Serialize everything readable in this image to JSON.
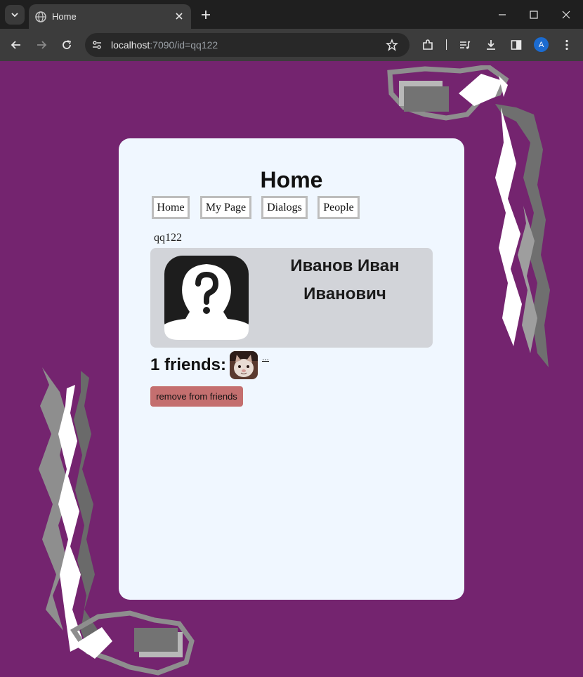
{
  "browser": {
    "tab_title": "Home",
    "url_host": "localhost",
    "url_rest": ":7090/id=qq122",
    "profile_initial": "A"
  },
  "page": {
    "heading": "Home",
    "nav": [
      {
        "label": "Home"
      },
      {
        "label": "My Page"
      },
      {
        "label": "Dialogs"
      },
      {
        "label": "People"
      }
    ],
    "login": "qq122",
    "profile": {
      "full_name_line1": "Иванов Иван",
      "full_name_line2": "Иванович"
    },
    "friends_label": "1 friends:",
    "friend_link": "...",
    "remove_button": "remove from friends"
  },
  "colors": {
    "page_bg": "#74246f",
    "card_bg": "#f0f7ff",
    "profile_bg": "#d2d4d9",
    "remove_button": "#c46f6f"
  }
}
